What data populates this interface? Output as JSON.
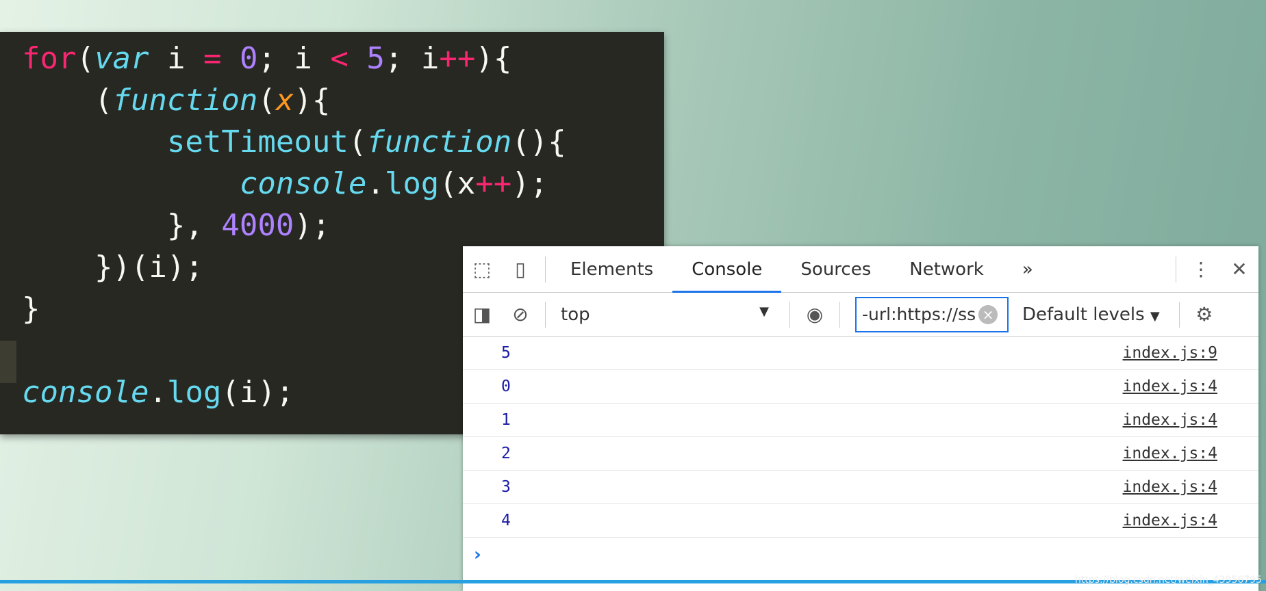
{
  "code": {
    "lines": [
      [
        {
          "t": "for",
          "c": "kw"
        },
        {
          "t": "(",
          "c": ""
        },
        {
          "t": "var",
          "c": "it"
        },
        {
          "t": " i ",
          "c": ""
        },
        {
          "t": "=",
          "c": "kw"
        },
        {
          "t": " ",
          "c": ""
        },
        {
          "t": "0",
          "c": "num"
        },
        {
          "t": "; i ",
          "c": ""
        },
        {
          "t": "<",
          "c": "kw"
        },
        {
          "t": " ",
          "c": ""
        },
        {
          "t": "5",
          "c": "num"
        },
        {
          "t": "; i",
          "c": ""
        },
        {
          "t": "++",
          "c": "kw"
        },
        {
          "t": "){",
          "c": ""
        }
      ],
      [
        {
          "t": "    (",
          "c": ""
        },
        {
          "t": "function",
          "c": "it"
        },
        {
          "t": "(",
          "c": ""
        },
        {
          "t": "x",
          "c": "arg"
        },
        {
          "t": "){",
          "c": ""
        }
      ],
      [
        {
          "t": "        ",
          "c": ""
        },
        {
          "t": "setTimeout",
          "c": "cy"
        },
        {
          "t": "(",
          "c": ""
        },
        {
          "t": "function",
          "c": "it"
        },
        {
          "t": "(){",
          "c": ""
        }
      ],
      [
        {
          "t": "            ",
          "c": ""
        },
        {
          "t": "console",
          "c": "it"
        },
        {
          "t": ".",
          "c": ""
        },
        {
          "t": "log",
          "c": "cy"
        },
        {
          "t": "(x",
          "c": ""
        },
        {
          "t": "++",
          "c": "kw"
        },
        {
          "t": ");",
          "c": ""
        }
      ],
      [
        {
          "t": "        }, ",
          "c": ""
        },
        {
          "t": "4000",
          "c": "num"
        },
        {
          "t": ");",
          "c": ""
        }
      ],
      [
        {
          "t": "    })(i);",
          "c": ""
        }
      ],
      [
        {
          "t": "}",
          "c": ""
        }
      ],
      [
        {
          "t": "",
          "c": ""
        }
      ],
      [
        {
          "t": "console",
          "c": "it"
        },
        {
          "t": ".",
          "c": ""
        },
        {
          "t": "log",
          "c": "cy"
        },
        {
          "t": "(i);",
          "c": ""
        }
      ]
    ]
  },
  "devtools": {
    "tabs": [
      "Elements",
      "Console",
      "Sources",
      "Network"
    ],
    "more": "»",
    "context": "top",
    "filter": "-url:https://ss",
    "levels": "Default levels",
    "rows": [
      {
        "value": "5",
        "source": "index.js:9"
      },
      {
        "value": "0",
        "source": "index.js:4"
      },
      {
        "value": "1",
        "source": "index.js:4"
      },
      {
        "value": "2",
        "source": "index.js:4"
      },
      {
        "value": "3",
        "source": "index.js:4"
      },
      {
        "value": "4",
        "source": "index.js:4"
      }
    ],
    "prompt": "›"
  },
  "watermark": "https://blog.csdn.net/weixin_43956795"
}
